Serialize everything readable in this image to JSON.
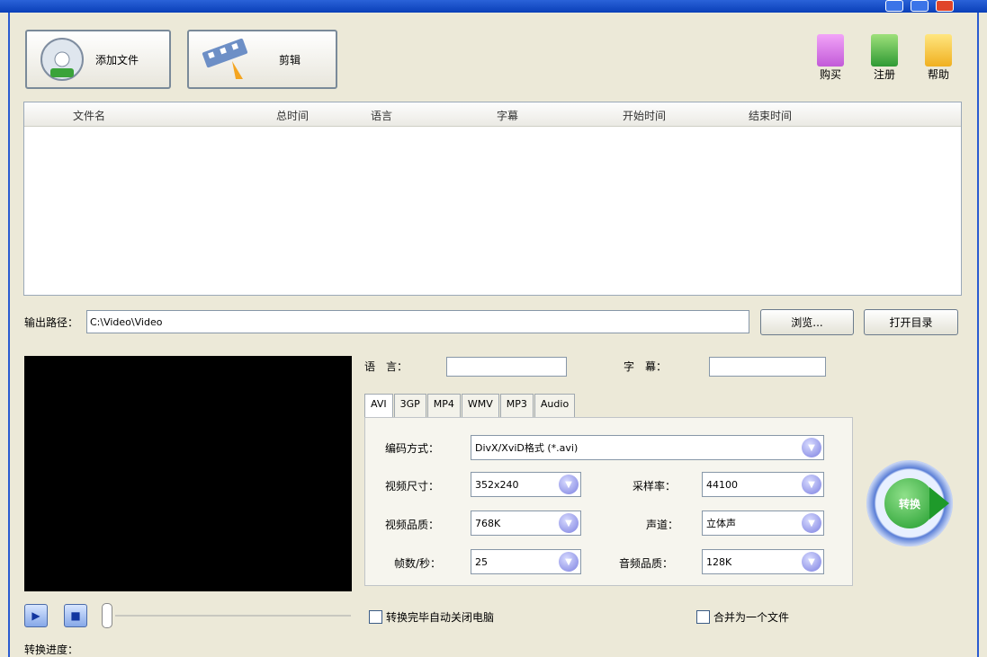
{
  "window": {
    "title": "",
    "colors": {
      "title_bar": "#0a3fb8",
      "face": "#ece9d8",
      "minimize": "#3b74e8",
      "maximize": "#3b74e8",
      "close": "#e0452a"
    }
  },
  "toolbar": {
    "add_file_label": "添加文件",
    "edit_label": "剪辑",
    "buy_label": "购买",
    "register_label": "注册",
    "help_label": "帮助"
  },
  "file_list": {
    "columns": [
      "文件名",
      "总时间",
      "语言",
      "字幕",
      "开始时间",
      "结束时间"
    ],
    "rows": []
  },
  "output": {
    "label": "输出路径：",
    "path": "C:\\Video\\Video",
    "browse_label": "浏览...",
    "open_dir_label": "打开目录"
  },
  "media": {
    "language_label": "语　言：",
    "language_value": "",
    "subtitle_label": "字　幕：",
    "subtitle_value": ""
  },
  "tabs": [
    "AVI",
    "3GP",
    "MP4",
    "WMV",
    "MP3",
    "Audio"
  ],
  "settings": {
    "encoder_label": "编码方式：",
    "encoder_value": "DivX/XviD格式 (*.avi)",
    "video_size_label": "视频尺寸：",
    "video_size_value": "352x240",
    "sample_rate_label": "采样率：",
    "sample_rate_value": "44100",
    "video_quality_label": "视频品质：",
    "video_quality_value": "768K",
    "channel_label": "声道：",
    "channel_value": "立体声",
    "fps_label": "帧数/秒：",
    "fps_value": "25",
    "audio_quality_label": "音频品质：",
    "audio_quality_value": "128K"
  },
  "options": {
    "shutdown_label": "转换完毕自动关闭电脑",
    "merge_label": "合并为一个文件"
  },
  "convert_label": "转换",
  "status": {
    "progress_label": "转换进度："
  }
}
